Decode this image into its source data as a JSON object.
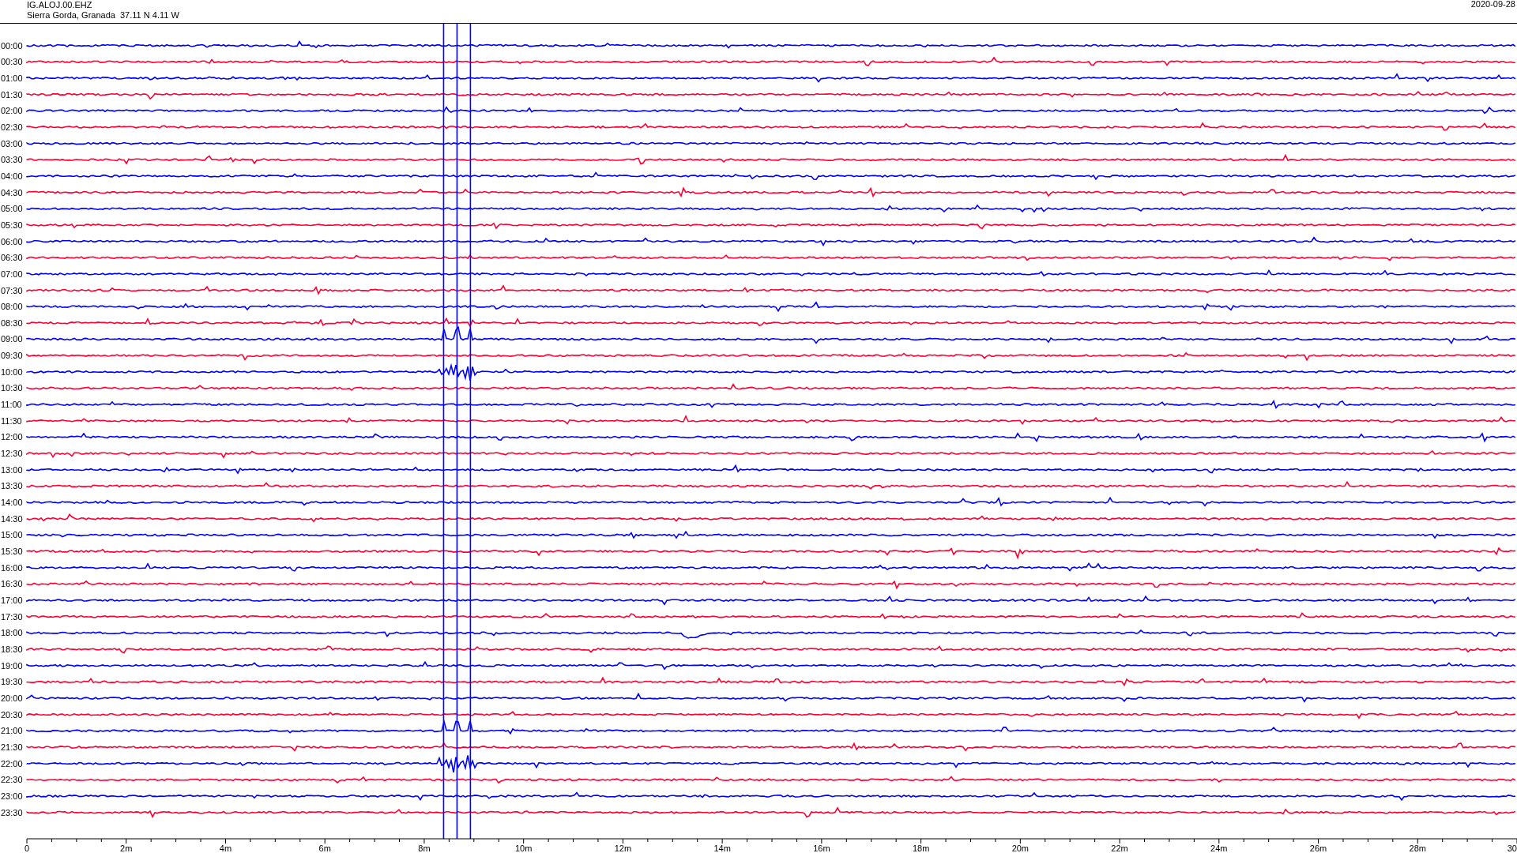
{
  "header": {
    "station": "IG.ALOJ.00.EHZ",
    "location": "Sierra Gorda, Granada  37.11 N 4.11 W",
    "date": "2020-09-28"
  },
  "rows": [
    {
      "time": "00:00",
      "color": "#0000ff"
    },
    {
      "time": "00:30",
      "color": "#ff0033"
    },
    {
      "time": "01:00",
      "color": "#0000ff"
    },
    {
      "time": "01:30",
      "color": "#ff0033"
    },
    {
      "time": "02:00",
      "color": "#0000ff"
    },
    {
      "time": "02:30",
      "color": "#ff0033"
    },
    {
      "time": "03:00",
      "color": "#0000ff"
    },
    {
      "time": "03:30",
      "color": "#ff0033"
    },
    {
      "time": "04:00",
      "color": "#0000ff"
    },
    {
      "time": "04:30",
      "color": "#ff0033"
    },
    {
      "time": "05:00",
      "color": "#0000ff"
    },
    {
      "time": "05:30",
      "color": "#ff0033"
    },
    {
      "time": "06:00",
      "color": "#0000ff"
    },
    {
      "time": "06:30",
      "color": "#ff0033"
    },
    {
      "time": "07:00",
      "color": "#0000ff"
    },
    {
      "time": "07:30",
      "color": "#ff0033"
    },
    {
      "time": "08:00",
      "color": "#0000ff"
    },
    {
      "time": "08:30",
      "color": "#ff0033"
    },
    {
      "time": "09:00",
      "color": "#0000ff"
    },
    {
      "time": "09:30",
      "color": "#ff0033"
    },
    {
      "time": "10:00",
      "color": "#0000ff"
    },
    {
      "time": "10:30",
      "color": "#ff0033"
    },
    {
      "time": "11:00",
      "color": "#0000ff"
    },
    {
      "time": "11:30",
      "color": "#ff0033"
    },
    {
      "time": "12:00",
      "color": "#0000ff"
    },
    {
      "time": "12:30",
      "color": "#ff0033"
    },
    {
      "time": "13:00",
      "color": "#0000ff"
    },
    {
      "time": "13:30",
      "color": "#ff0033"
    },
    {
      "time": "14:00",
      "color": "#0000ff"
    },
    {
      "time": "14:30",
      "color": "#ff0033"
    },
    {
      "time": "15:00",
      "color": "#0000ff"
    },
    {
      "time": "15:30",
      "color": "#ff0033"
    },
    {
      "time": "16:00",
      "color": "#0000ff"
    },
    {
      "time": "16:30",
      "color": "#ff0033"
    },
    {
      "time": "17:00",
      "color": "#0000ff"
    },
    {
      "time": "17:30",
      "color": "#ff0033"
    },
    {
      "time": "18:00",
      "color": "#0000ff"
    },
    {
      "time": "18:30",
      "color": "#ff0033"
    },
    {
      "time": "19:00",
      "color": "#0000ff"
    },
    {
      "time": "19:30",
      "color": "#ff0033"
    },
    {
      "time": "20:00",
      "color": "#0000ff"
    },
    {
      "time": "20:30",
      "color": "#ff0033"
    },
    {
      "time": "21:00",
      "color": "#0000ff"
    },
    {
      "time": "21:30",
      "color": "#ff0033"
    },
    {
      "time": "22:00",
      "color": "#0000ff"
    },
    {
      "time": "22:30",
      "color": "#ff0033"
    },
    {
      "time": "23:00",
      "color": "#0000ff"
    },
    {
      "time": "23:30",
      "color": "#ff0033"
    }
  ],
  "x_axis": {
    "ticks": [
      "0",
      "2m",
      "4m",
      "6m",
      "8m",
      "10m",
      "12m",
      "14m",
      "16m",
      "18m",
      "20m",
      "22m",
      "24m",
      "26m",
      "28m",
      "30"
    ]
  }
}
